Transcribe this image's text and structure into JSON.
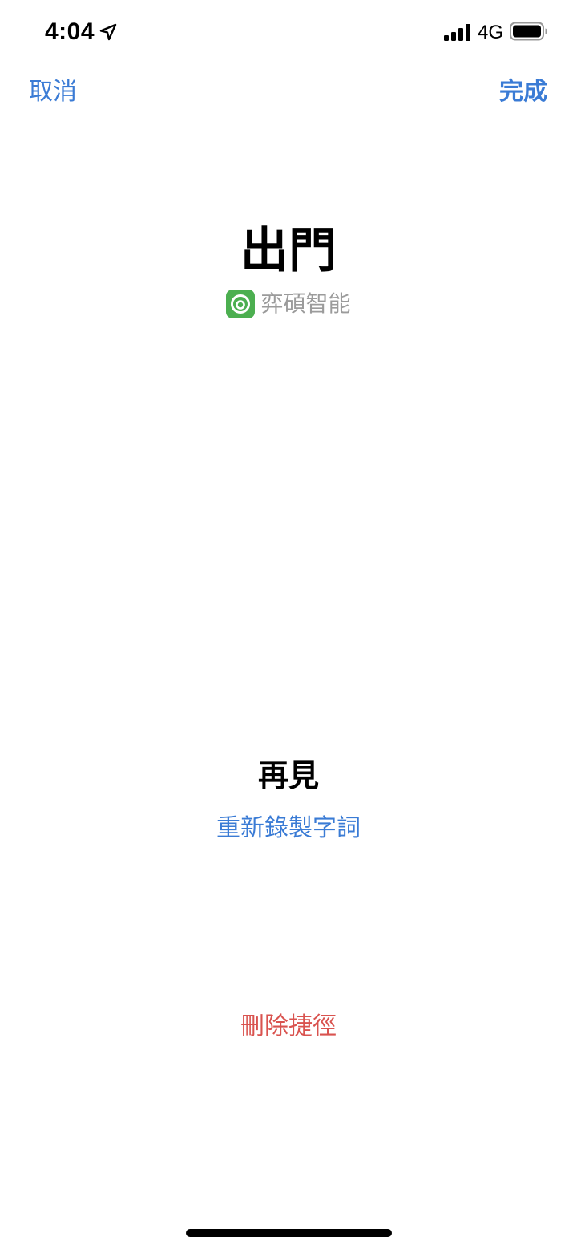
{
  "status_bar": {
    "time": "4:04",
    "network": "4G",
    "icons": [
      "location-arrow-icon",
      "cellular-signal-icon",
      "battery-icon"
    ]
  },
  "nav": {
    "cancel_label": "取消",
    "done_label": "完成"
  },
  "shortcut": {
    "title": "出門",
    "app_name": "弈碩智能",
    "app_icon": "app-logo-icon",
    "app_icon_color": "#4caf50"
  },
  "voice": {
    "phrase": "再見",
    "rerecord_label": "重新錄製字詞"
  },
  "actions": {
    "delete_label": "刪除捷徑"
  },
  "colors": {
    "accent": "#3a7bd5",
    "destructive": "#d9534f",
    "secondary_text": "#9b9b9b"
  }
}
